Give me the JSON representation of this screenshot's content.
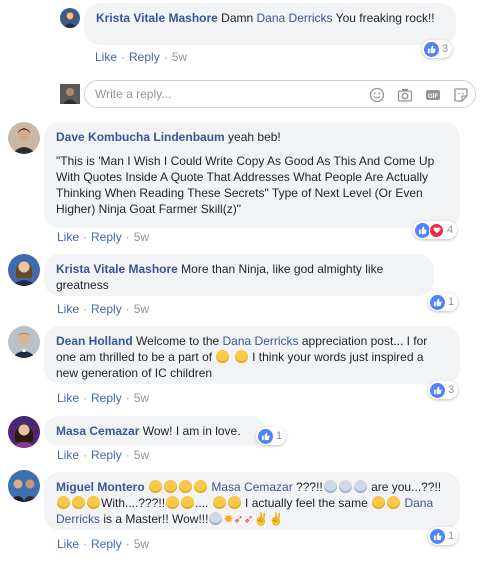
{
  "colors": {
    "link": "#365899",
    "action": "#4267b2",
    "meta": "#90949c",
    "bubble": "#f2f3f5"
  },
  "reply_input": {
    "placeholder": "Write a reply..."
  },
  "input_icons": [
    "emoji-icon",
    "camera-icon",
    "gif-icon",
    "sticker-icon"
  ],
  "actions": {
    "like": "Like",
    "reply": "Reply"
  },
  "comments": [
    {
      "name": "Krista Vitale Mashore",
      "text_1": "Damn ",
      "mention": "Dana Derricks",
      "text_2": " You freaking rock!!",
      "time": "5w",
      "reactions": "3"
    },
    {
      "name": "Dave Kombucha Lindenbaum",
      "text_1": "yeah beb!",
      "text_2": "\"This is 'Man I Wish I Could Write Copy As Good As This And Come Up With Quotes Inside A Quote That Addresses What People Are Actually Thinking When Reading These Secrets\" Type of Next Level (Or Even Higher) Ninja Goat Farmer Skill(z)\"",
      "time": "5w",
      "reactions": "4"
    },
    {
      "name": "Krista Vitale Mashore",
      "text_1": "More than Ninja, like god almighty like greatness",
      "time": "5w",
      "reactions": "1"
    },
    {
      "name": "Dean Holland",
      "text_1": "Welcome to the ",
      "mention": "Dana Derricks",
      "text_2": " appreciation post... I for one am thrilled to be a part of ",
      "text_3": " I think your words just inspired a new generation of IC children",
      "time": "5w",
      "reactions": "3"
    },
    {
      "name": "Masa Cemazar",
      "text_1": "Wow! I am in love.",
      "time": "5w",
      "reactions": "1"
    },
    {
      "name": "Miguel Montero",
      "mention": "Masa Cemazar",
      "text_1": " ???!!",
      "text_2": " are you...??!!",
      "text_3": "With....???!!",
      "text_4": ".... ",
      "text_5": " I actually feel the same ",
      "mention_2": "Dana Derricks",
      "text_6": " is a Master!! Wow!!!",
      "time": "5w",
      "reactions": "1"
    }
  ]
}
